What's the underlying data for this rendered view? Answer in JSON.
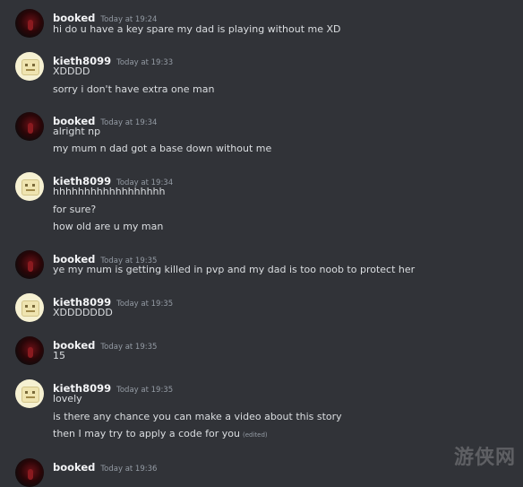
{
  "messages": [
    {
      "author": "booked",
      "time": "Today at 19:24",
      "avatar": "red-avatar",
      "lines": [
        "hi do u have a key spare my dad is playing without me XD"
      ]
    },
    {
      "author": "kieth8099",
      "time": "Today at 19:33",
      "avatar": "cream-avatar",
      "lines": [
        "XDDDD",
        "sorry i don't have extra one man"
      ]
    },
    {
      "author": "booked",
      "time": "Today at 19:34",
      "avatar": "red-avatar",
      "lines": [
        "alright np",
        "my mum n dad got a base down without me"
      ]
    },
    {
      "author": "kieth8099",
      "time": "Today at 19:34",
      "avatar": "cream-avatar",
      "lines": [
        "hhhhhhhhhhhhhhhhhh",
        "for sure?",
        "how old are u my man"
      ]
    },
    {
      "author": "booked",
      "time": "Today at 19:35",
      "avatar": "red-avatar",
      "lines": [
        "ye my mum is getting killed in pvp and my dad is too noob to protect her"
      ]
    },
    {
      "author": "kieth8099",
      "time": "Today at 19:35",
      "avatar": "cream-avatar",
      "lines": [
        "XDDDDDDD"
      ]
    },
    {
      "author": "booked",
      "time": "Today at 19:35",
      "avatar": "red-avatar",
      "lines": [
        "15"
      ]
    },
    {
      "author": "kieth8099",
      "time": "Today at 19:35",
      "avatar": "cream-avatar",
      "lines": [
        "lovely",
        "is there any chance you can make a video about this story",
        "then I may try to apply a code for you"
      ],
      "edited": "(edited)"
    },
    {
      "author": "booked",
      "time": "Today at 19:36",
      "avatar": "red-avatar",
      "lines": []
    }
  ],
  "watermark": "游侠网",
  "colors": {
    "background": "#313338",
    "text": "#dbdee1",
    "username": "#f2f3f5",
    "timestamp": "#949ba4"
  }
}
